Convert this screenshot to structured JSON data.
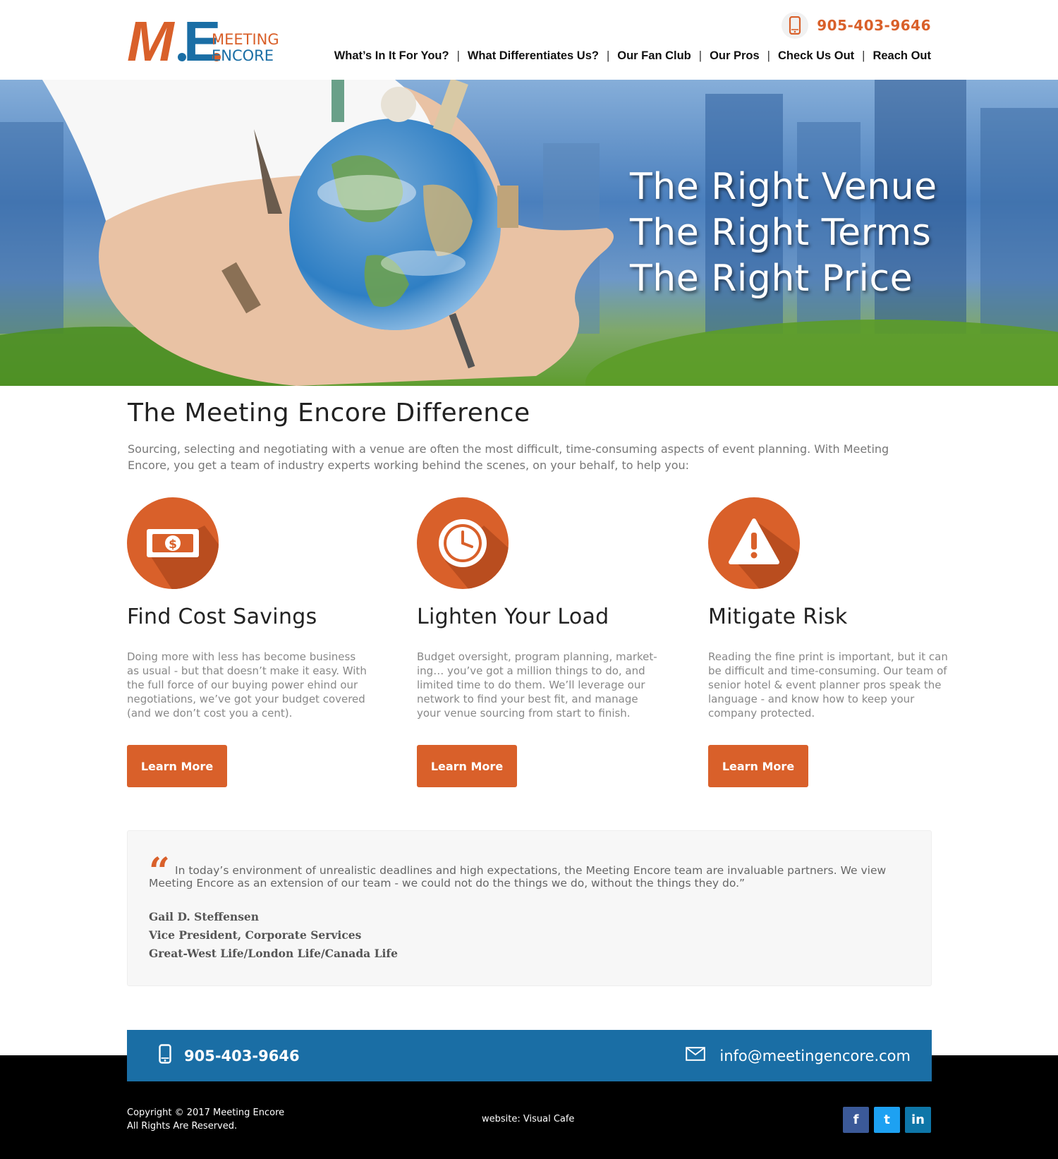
{
  "brand": {
    "logo_initials": "M.E.",
    "logo_line1": "MEETING",
    "logo_line2": "ENCORE",
    "accent_color": "#d9602a",
    "blue_color": "#1a6ea5"
  },
  "header": {
    "phone": "905-403-9646",
    "nav": [
      {
        "label": "What’s In It For You?"
      },
      {
        "label": "What Differentiates Us?"
      },
      {
        "label": "Our Fan Club"
      },
      {
        "label": "Our Pros"
      },
      {
        "label": "Check Us Out"
      },
      {
        "label": "Reach Out"
      }
    ],
    "nav_separator": "|"
  },
  "hero": {
    "line1": "The Right Venue",
    "line2": "The Right Terms",
    "line3": "The Right Price"
  },
  "difference": {
    "title": "The Meeting Encore Difference",
    "intro": "Sourcing, selecting and negotiating with a venue are often the most difficult, time-consuming aspects of event planning. With Meeting Encore, you get a team of industry experts working behind the scenes, on your behalf, to help you:"
  },
  "features": [
    {
      "icon": "money-icon",
      "title": "Find Cost Savings",
      "text": "Doing more with less has become business as usual - but that doesn’t make it easy. With the full force of our buying power ehind our negotiations, we’ve got your budget covered (and we don’t cost you a cent).",
      "button": "Learn More"
    },
    {
      "icon": "clock-icon",
      "title": "Lighten Your Load",
      "text": "Budget oversight, program planning, market-ing… you’ve got a million things to do, and limited time to do them. We’ll leverage our network to find your best fit, and manage your venue sourcing from start to finish.",
      "button": "Learn More"
    },
    {
      "icon": "warning-icon",
      "title": "Mitigate Risk",
      "text": "Reading the fine print is important, but it can be difficult and time-consuming. Our team of senior hotel & event planner pros speak the language - and know how to keep your company protected.",
      "button": "Learn More"
    }
  ],
  "testimonial": {
    "quote_mark": "“",
    "quote": "In today’s environment of unrealistic deadlines and high expectations, the Meeting Encore team are invaluable partners. We view Meeting Encore as an extension of our team - we could not do the things we do, without the things they do.”",
    "name": "Gail D. Steffensen",
    "role": "Vice President, Corporate Services",
    "company": "Great-West Life/London Life/Canada Life"
  },
  "contact_bar": {
    "phone": "905-403-9646",
    "email": "info@meetingencore.com"
  },
  "footer": {
    "copyright_line1": "Copyright © 2017 Meeting Encore",
    "copyright_line2": "All Rights Are Reserved.",
    "website_credit": "website: Visual Cafe",
    "socials": [
      {
        "icon": "facebook-icon",
        "glyph": "f",
        "color": "#3b5998"
      },
      {
        "icon": "twitter-icon",
        "glyph": "t",
        "color": "#1da1f2"
      },
      {
        "icon": "linkedin-icon",
        "glyph": "in",
        "color": "#0e76a8"
      }
    ]
  }
}
